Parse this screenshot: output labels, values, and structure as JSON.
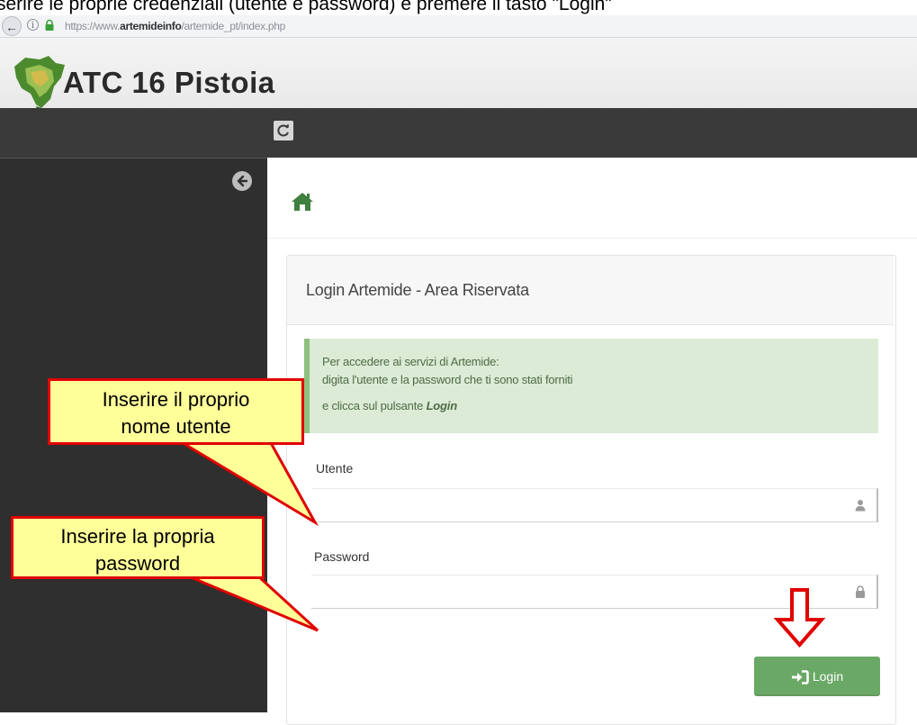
{
  "caption": "serire le proprie credenziali (utente e password) e premere il tasto \"Login\"",
  "browser": {
    "url_prefix": "https://www.",
    "url_domain": "artemideinfo",
    "url_path": "/artemide_pt/index.php"
  },
  "app": {
    "title": "ATC 16 Pistoia"
  },
  "panel": {
    "title": "Login Artemide - Area Riservata"
  },
  "alert": {
    "line1": "Per accedere ai servizi di Artemide:",
    "line2": "digita l'utente e la password che ti sono stati forniti",
    "line3_prefix": "e clicca sul pulsante ",
    "line3_emph": "Login"
  },
  "form": {
    "username_label": "Utente",
    "username_value": "",
    "password_label": "Password",
    "password_value": ""
  },
  "login_button": {
    "label": "Login"
  },
  "callouts": {
    "username": {
      "line1": "Inserire il proprio",
      "line2": "nome utente"
    },
    "password": {
      "line1": "Inserire la propria",
      "line2": "password"
    }
  },
  "colors": {
    "accent_green": "#6aa866",
    "callout_fill": "#ffff99",
    "callout_border": "#e00000",
    "sidebar": "#2f2f2f",
    "toolbar": "#3a3a3a"
  },
  "icons": [
    "back-arrow-icon",
    "info-icon",
    "lock-icon",
    "logo",
    "refresh-icon",
    "collapse-arrow-icon",
    "home-icon",
    "user-icon",
    "password-lock-icon",
    "sign-in-icon",
    "down-arrow-icon"
  ]
}
